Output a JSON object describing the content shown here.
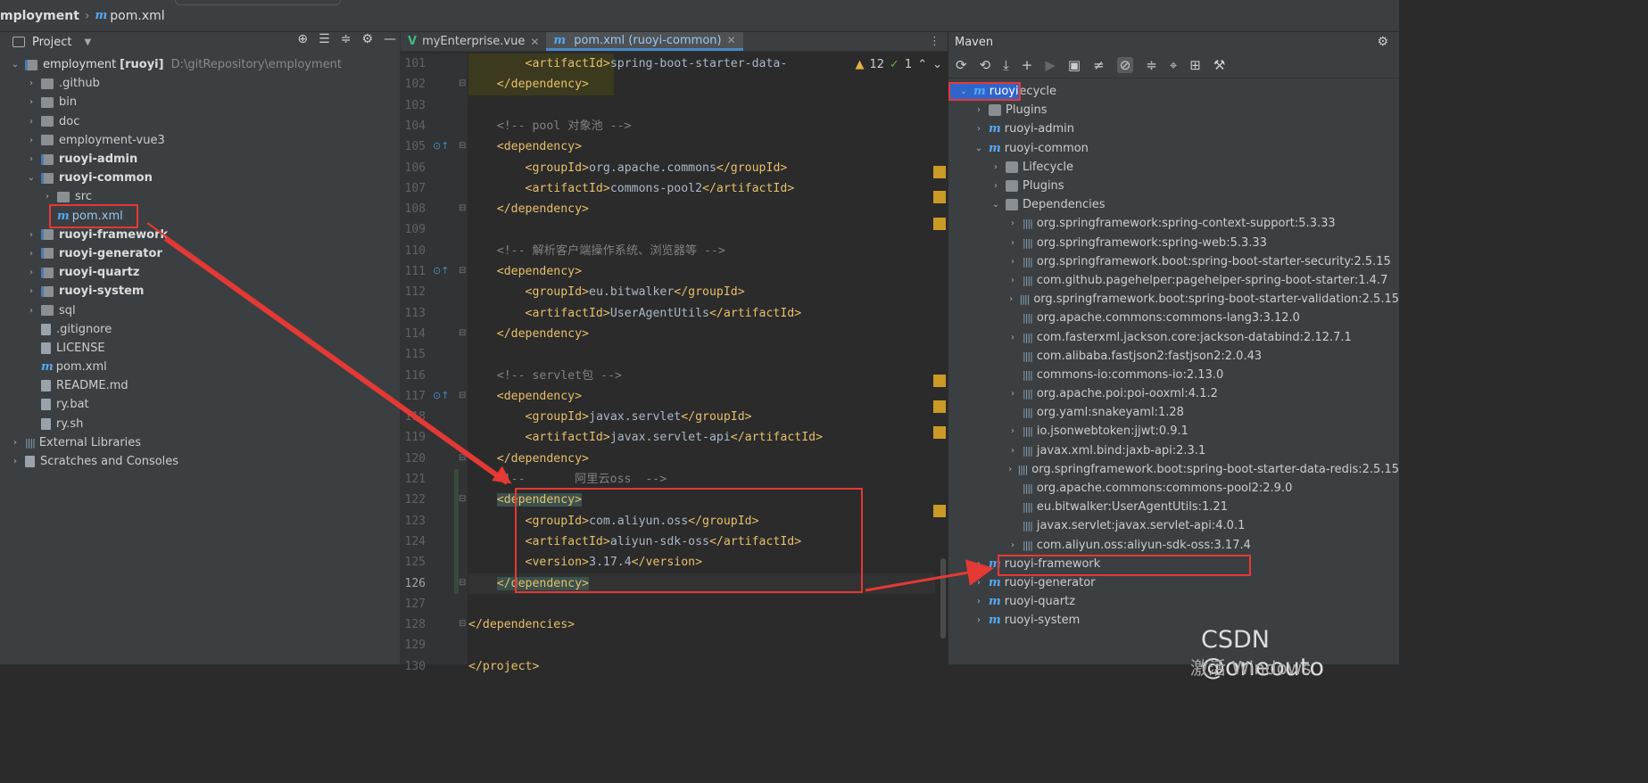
{
  "breadcrumb": {
    "project": "mployment",
    "file": "pom.xml"
  },
  "project_panel": {
    "title": "Project",
    "root": {
      "name": "employment",
      "module": "[ruoyi]",
      "path": "D:\\gitRepository\\employment"
    },
    "items": [
      {
        "label": ".github",
        "bold": false,
        "level": 1,
        "arrow": "›",
        "icon": "folder"
      },
      {
        "label": "bin",
        "bold": false,
        "level": 1,
        "arrow": "›",
        "icon": "folder"
      },
      {
        "label": "doc",
        "bold": false,
        "level": 1,
        "arrow": "›",
        "icon": "folder"
      },
      {
        "label": "employment-vue3",
        "bold": false,
        "level": 1,
        "arrow": "›",
        "icon": "folder"
      },
      {
        "label": "ruoyi-admin",
        "bold": true,
        "level": 1,
        "arrow": "›",
        "icon": "module"
      },
      {
        "label": "ruoyi-common",
        "bold": true,
        "level": 1,
        "arrow": "⌄",
        "icon": "module"
      },
      {
        "label": "src",
        "bold": false,
        "level": 2,
        "arrow": "›",
        "icon": "folder"
      },
      {
        "label": "pom.xml",
        "bold": false,
        "level": 2,
        "arrow": "",
        "icon": "maven"
      },
      {
        "label": "ruoyi-framework",
        "bold": true,
        "level": 1,
        "arrow": "›",
        "icon": "module"
      },
      {
        "label": "ruoyi-generator",
        "bold": true,
        "level": 1,
        "arrow": "›",
        "icon": "module"
      },
      {
        "label": "ruoyi-quartz",
        "bold": true,
        "level": 1,
        "arrow": "›",
        "icon": "module"
      },
      {
        "label": "ruoyi-system",
        "bold": true,
        "level": 1,
        "arrow": "›",
        "icon": "module"
      },
      {
        "label": "sql",
        "bold": false,
        "level": 1,
        "arrow": "›",
        "icon": "folder"
      },
      {
        "label": ".gitignore",
        "bold": false,
        "level": 1,
        "arrow": "",
        "icon": "file"
      },
      {
        "label": "LICENSE",
        "bold": false,
        "level": 1,
        "arrow": "",
        "icon": "file"
      },
      {
        "label": "pom.xml",
        "bold": false,
        "level": 1,
        "arrow": "",
        "icon": "maven"
      },
      {
        "label": "README.md",
        "bold": false,
        "level": 1,
        "arrow": "",
        "icon": "file"
      },
      {
        "label": "ry.bat",
        "bold": false,
        "level": 1,
        "arrow": "",
        "icon": "file"
      },
      {
        "label": "ry.sh",
        "bold": false,
        "level": 1,
        "arrow": "",
        "icon": "file"
      },
      {
        "label": "External Libraries",
        "bold": false,
        "level": 0,
        "arrow": "›",
        "icon": "lib"
      },
      {
        "label": "Scratches and Consoles",
        "bold": false,
        "level": 0,
        "arrow": "›",
        "icon": "file"
      }
    ]
  },
  "editor": {
    "tabs": [
      {
        "label": "myEnterprise.vue",
        "icon": "V",
        "active": false
      },
      {
        "label": "pom.xml (ruoyi-common)",
        "icon": "m",
        "active": true
      }
    ],
    "inspection": {
      "warnings": "12",
      "ok": "1"
    },
    "lines": [
      {
        "n": "101",
        "code": "        <artifactId>spring-boot-starter-data-"
      },
      {
        "n": "102",
        "code": "    </dependency>"
      },
      {
        "n": "103",
        "code": ""
      },
      {
        "n": "104",
        "code": "    <!-- pool 对象池 -->"
      },
      {
        "n": "105",
        "code": "    <dependency>"
      },
      {
        "n": "106",
        "code": "        <groupId>org.apache.commons</groupId>"
      },
      {
        "n": "107",
        "code": "        <artifactId>commons-pool2</artifactId>"
      },
      {
        "n": "108",
        "code": "    </dependency>"
      },
      {
        "n": "109",
        "code": ""
      },
      {
        "n": "110",
        "code": "    <!-- 解析客户端操作系统、浏览器等 -->"
      },
      {
        "n": "111",
        "code": "    <dependency>"
      },
      {
        "n": "112",
        "code": "        <groupId>eu.bitwalker</groupId>"
      },
      {
        "n": "113",
        "code": "        <artifactId>UserAgentUtils</artifactId>"
      },
      {
        "n": "114",
        "code": "    </dependency>"
      },
      {
        "n": "115",
        "code": ""
      },
      {
        "n": "116",
        "code": "    <!-- servlet包 -->"
      },
      {
        "n": "117",
        "code": "    <dependency>"
      },
      {
        "n": "118",
        "code": "        <groupId>javax.servlet</groupId>"
      },
      {
        "n": "119",
        "code": "        <artifactId>javax.servlet-api</artifactId>"
      },
      {
        "n": "120",
        "code": "    </dependency>"
      },
      {
        "n": "121",
        "code": "    <!--       阿里云oss  -->"
      },
      {
        "n": "122",
        "code": "    <dependency>"
      },
      {
        "n": "123",
        "code": "        <groupId>com.aliyun.oss</groupId>"
      },
      {
        "n": "124",
        "code": "        <artifactId>aliyun-sdk-oss</artifactId>"
      },
      {
        "n": "125",
        "code": "        <version>3.17.4</version>"
      },
      {
        "n": "126",
        "code": "    </dependency>"
      },
      {
        "n": "127",
        "code": ""
      },
      {
        "n": "128",
        "code": "</dependencies>"
      },
      {
        "n": "129",
        "code": ""
      },
      {
        "n": "130",
        "code": "</project>"
      }
    ]
  },
  "maven": {
    "title": "Maven",
    "rows": [
      {
        "label": "ruoyi",
        "level": 0,
        "arrow": "⌄",
        "icon": "m",
        "selected": true
      },
      {
        "label": "Lifecycle",
        "level": 1,
        "arrow": "›",
        "icon": "gear",
        "selected": false
      },
      {
        "label": "Plugins",
        "level": 1,
        "arrow": "›",
        "icon": "gear",
        "selected": false
      },
      {
        "label": "ruoyi-admin",
        "level": 1,
        "arrow": "›",
        "icon": "m",
        "selected": false
      },
      {
        "label": "ruoyi-common",
        "level": 1,
        "arrow": "⌄",
        "icon": "m",
        "selected": false
      },
      {
        "label": "Lifecycle",
        "level": 2,
        "arrow": "›",
        "icon": "gear",
        "selected": false
      },
      {
        "label": "Plugins",
        "level": 2,
        "arrow": "›",
        "icon": "gear",
        "selected": false
      },
      {
        "label": "Dependencies",
        "level": 2,
        "arrow": "⌄",
        "icon": "gear",
        "selected": false
      },
      {
        "label": "org.springframework:spring-context-support:5.3.33",
        "level": 3,
        "arrow": "›",
        "icon": "bar",
        "selected": false
      },
      {
        "label": "org.springframework:spring-web:5.3.33",
        "level": 3,
        "arrow": "›",
        "icon": "bar",
        "selected": false
      },
      {
        "label": "org.springframework.boot:spring-boot-starter-security:2.5.15",
        "level": 3,
        "arrow": "›",
        "icon": "bar",
        "selected": false
      },
      {
        "label": "com.github.pagehelper:pagehelper-spring-boot-starter:1.4.7",
        "level": 3,
        "arrow": "›",
        "icon": "bar",
        "selected": false
      },
      {
        "label": "org.springframework.boot:spring-boot-starter-validation:2.5.15",
        "level": 3,
        "arrow": "›",
        "icon": "bar",
        "selected": false
      },
      {
        "label": "org.apache.commons:commons-lang3:3.12.0",
        "level": 3,
        "arrow": "",
        "icon": "bar",
        "selected": false
      },
      {
        "label": "com.fasterxml.jackson.core:jackson-databind:2.12.7.1",
        "level": 3,
        "arrow": "›",
        "icon": "bar",
        "selected": false
      },
      {
        "label": "com.alibaba.fastjson2:fastjson2:2.0.43",
        "level": 3,
        "arrow": "",
        "icon": "bar",
        "selected": false
      },
      {
        "label": "commons-io:commons-io:2.13.0",
        "level": 3,
        "arrow": "",
        "icon": "bar",
        "selected": false
      },
      {
        "label": "org.apache.poi:poi-ooxml:4.1.2",
        "level": 3,
        "arrow": "›",
        "icon": "bar",
        "selected": false
      },
      {
        "label": "org.yaml:snakeyaml:1.28",
        "level": 3,
        "arrow": "",
        "icon": "bar",
        "selected": false
      },
      {
        "label": "io.jsonwebtoken:jjwt:0.9.1",
        "level": 3,
        "arrow": "›",
        "icon": "bar",
        "selected": false
      },
      {
        "label": "javax.xml.bind:jaxb-api:2.3.1",
        "level": 3,
        "arrow": "›",
        "icon": "bar",
        "selected": false
      },
      {
        "label": "org.springframework.boot:spring-boot-starter-data-redis:2.5.15",
        "level": 3,
        "arrow": "›",
        "icon": "bar",
        "selected": false
      },
      {
        "label": "org.apache.commons:commons-pool2:2.9.0",
        "level": 3,
        "arrow": "",
        "icon": "bar",
        "selected": false
      },
      {
        "label": "eu.bitwalker:UserAgentUtils:1.21",
        "level": 3,
        "arrow": "",
        "icon": "bar",
        "selected": false
      },
      {
        "label": "javax.servlet:javax.servlet-api:4.0.1",
        "level": 3,
        "arrow": "",
        "icon": "bar",
        "selected": false
      },
      {
        "label": "com.aliyun.oss:aliyun-sdk-oss:3.17.4",
        "level": 3,
        "arrow": "›",
        "icon": "bar",
        "selected": false
      },
      {
        "label": "ruoyi-framework",
        "level": 1,
        "arrow": "›",
        "icon": "m",
        "selected": false
      },
      {
        "label": "ruoyi-generator",
        "level": 1,
        "arrow": "›",
        "icon": "m",
        "selected": false
      },
      {
        "label": "ruoyi-quartz",
        "level": 1,
        "arrow": "›",
        "icon": "m",
        "selected": false
      },
      {
        "label": "ruoyi-system",
        "level": 1,
        "arrow": "›",
        "icon": "m",
        "selected": false
      }
    ]
  },
  "watermark": {
    "text": "CSDN @oneouto",
    "activate": "激活 Windows"
  },
  "colors": {
    "accent": "#2f65ca",
    "annotation": "#e53935",
    "tag": "#e8bf6a",
    "comment": "#808080"
  }
}
